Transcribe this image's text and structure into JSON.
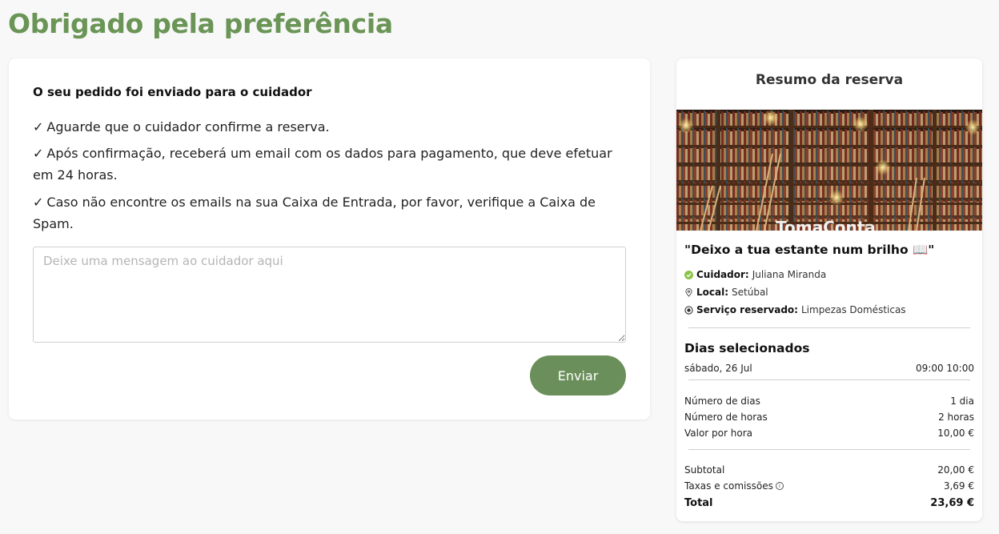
{
  "page": {
    "title": "Obrigado pela preferência"
  },
  "confirmation": {
    "heading": "O seu pedido foi enviado para o cuidador",
    "check_symbol": "✓",
    "steps": [
      "Aguarde que o cuidador confirme a reserva.",
      "Após confirmação, receberá um email com os dados para pagamento, que deve efetuar em 24 horas.",
      "Caso não encontre os emails na sua Caixa de Entrada, por favor, verifique a Caixa de Spam."
    ],
    "message": {
      "placeholder": "Deixe uma mensagem ao cuidador aqui",
      "value": ""
    },
    "send_label": "Enviar"
  },
  "summary": {
    "title": "Resumo da reserva",
    "image_watermark": "TomaConta",
    "service_title": "\"Deixo a tua estante num brilho 📖\"",
    "caregiver_label": "Cuidador:",
    "caregiver_value": "Juliana Miranda",
    "location_label": "Local:",
    "location_value": "Setúbal",
    "service_label": "Serviço reservado:",
    "service_value": "Limpezas Domésticas",
    "days_heading": "Dias selecionados",
    "days": [
      {
        "date": "sábado, 26 Jul",
        "time": "09:00 10:00"
      }
    ],
    "details": [
      {
        "label": "Número de dias",
        "value": "1 dia"
      },
      {
        "label": "Número de horas",
        "value": "2 horas"
      },
      {
        "label": "Valor por hora",
        "value": "10,00 €"
      }
    ],
    "subtotal_label": "Subtotal",
    "subtotal_value": "20,00 €",
    "fees_label": "Taxas e comissões",
    "fees_value": "3,69 €",
    "total_label": "Total",
    "total_value": "23,69 €"
  },
  "colors": {
    "accent": "#6a9556",
    "button": "#6a8f5a",
    "verified": "#8bc34a"
  },
  "icons": {
    "caregiver": "check-circle-icon",
    "location": "map-pin-icon",
    "service": "radio-dot-icon",
    "fees_info": "info-icon"
  }
}
